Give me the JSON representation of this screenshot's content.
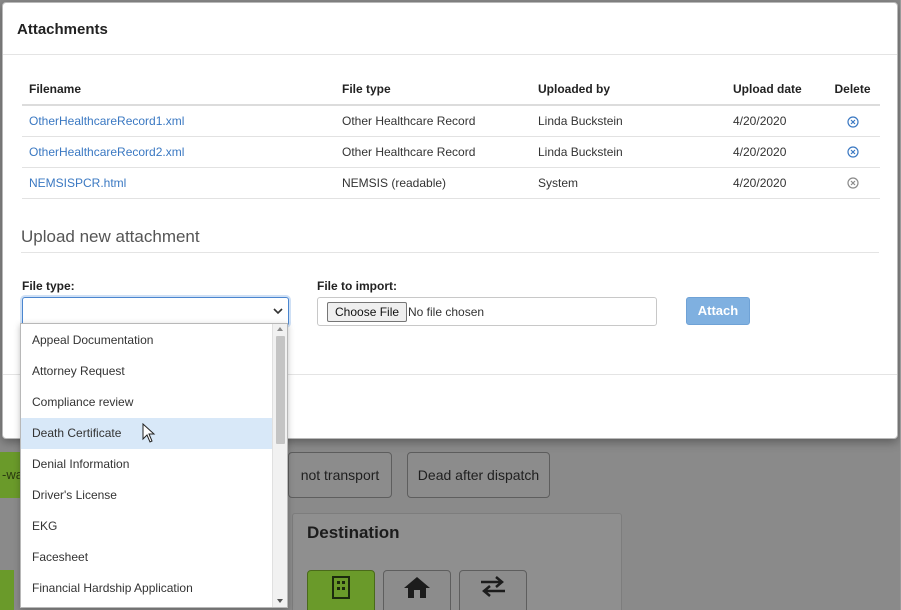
{
  "modal": {
    "title": "Attachments"
  },
  "table": {
    "headers": {
      "filename": "Filename",
      "file_type": "File type",
      "uploaded_by": "Uploaded by",
      "upload_date": "Upload date",
      "delete": "Delete"
    },
    "rows": [
      {
        "filename": "OtherHealthcareRecord1.xml",
        "file_type": "Other Healthcare Record",
        "uploaded_by": "Linda Buckstein",
        "upload_date": "4/20/2020",
        "deletable": true
      },
      {
        "filename": "OtherHealthcareRecord2.xml",
        "file_type": "Other Healthcare Record",
        "uploaded_by": "Linda Buckstein",
        "upload_date": "4/20/2020",
        "deletable": true
      },
      {
        "filename": "NEMSISPCR.html",
        "file_type": "NEMSIS (readable)",
        "uploaded_by": "System",
        "upload_date": "4/20/2020",
        "deletable": false
      }
    ]
  },
  "upload": {
    "section_title": "Upload new attachment",
    "file_type_label": "File type:",
    "file_type_value": "",
    "file_import_label": "File to import:",
    "choose_file_label": "Choose File",
    "no_file_text": "No file chosen",
    "attach_label": "Attach"
  },
  "dropdown": {
    "options": [
      "Appeal Documentation",
      "Attorney Request",
      "Compliance review",
      "Death Certificate",
      "Denial Information",
      "Driver's License",
      "EKG",
      "Facesheet",
      "Financial Hardship Application"
    ],
    "highlighted_option": "Death Certificate"
  },
  "background": {
    "left_tab_text": "-wa",
    "button_1": "not transport",
    "button_2": "Dead after dispatch",
    "destination_title": "Destination"
  },
  "colors": {
    "link": "#3a78c2",
    "attach_button": "#7fb0e0",
    "highlight": "#d8e8f8",
    "focus_border": "#4b86cf",
    "delete_active": "#3a78c2",
    "delete_disabled": "#8a8a8a"
  }
}
